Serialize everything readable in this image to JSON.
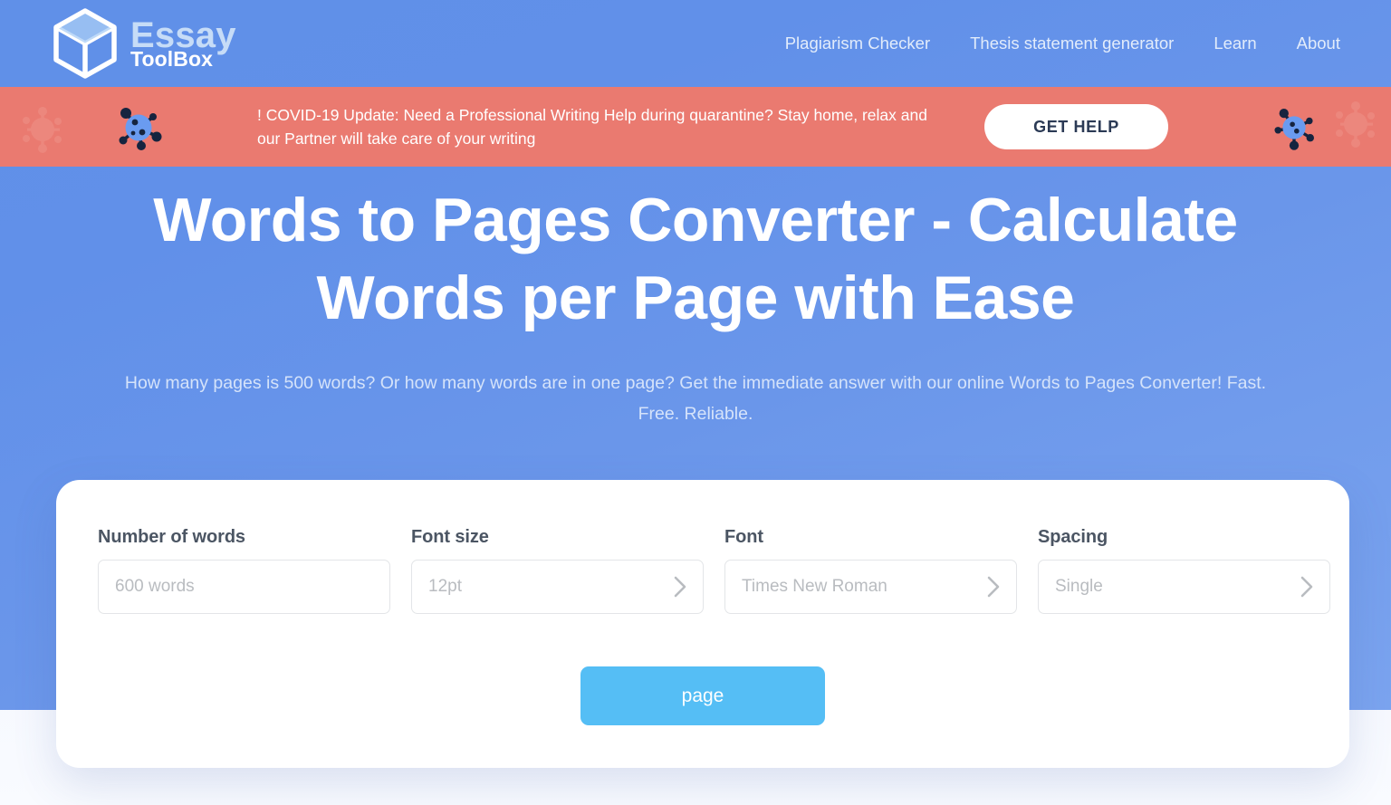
{
  "brand": {
    "name_primary": "Essay",
    "name_secondary": "ToolBox",
    "logo_icon": "cube-icon",
    "primary_color": "#c6dcf7",
    "secondary_color": "#ffffff"
  },
  "nav": {
    "items": [
      {
        "label": "Plagiarism Checker"
      },
      {
        "label": "Thesis statement generator"
      },
      {
        "label": "Learn"
      },
      {
        "label": "About"
      }
    ]
  },
  "banner": {
    "text": "! COVID-19 Update: Need a Professional Writing Help during quarantine? Stay home, relax and our Partner will take care of your writing",
    "cta_label": "GET HELP",
    "background_color": "#ea7a70",
    "icon": "virus-icon"
  },
  "hero": {
    "title": "Words to Pages Converter - Calculate Words per Page with Ease",
    "subtitle": "How many pages is 500 words? Or how many words are in one page? Get the immediate answer with our online Words to Pages Converter! Fast. Free. Reliable.",
    "background_color": "#6190e9"
  },
  "form": {
    "fields": [
      {
        "label": "Number of words",
        "value": "600 words",
        "placeholder": "600 words",
        "type": "text",
        "has_chevron": false
      },
      {
        "label": "Font size",
        "value": "12pt",
        "placeholder": "12pt",
        "type": "select",
        "has_chevron": true
      },
      {
        "label": "Font",
        "value": "Times New Roman",
        "placeholder": "Times New Roman",
        "type": "select",
        "has_chevron": true
      },
      {
        "label": "Spacing",
        "value": "Single",
        "placeholder": "Single",
        "type": "select",
        "has_chevron": true
      }
    ],
    "submit_label": "page",
    "submit_color": "#55bef5",
    "chevron_icon": "chevron-right-icon"
  }
}
